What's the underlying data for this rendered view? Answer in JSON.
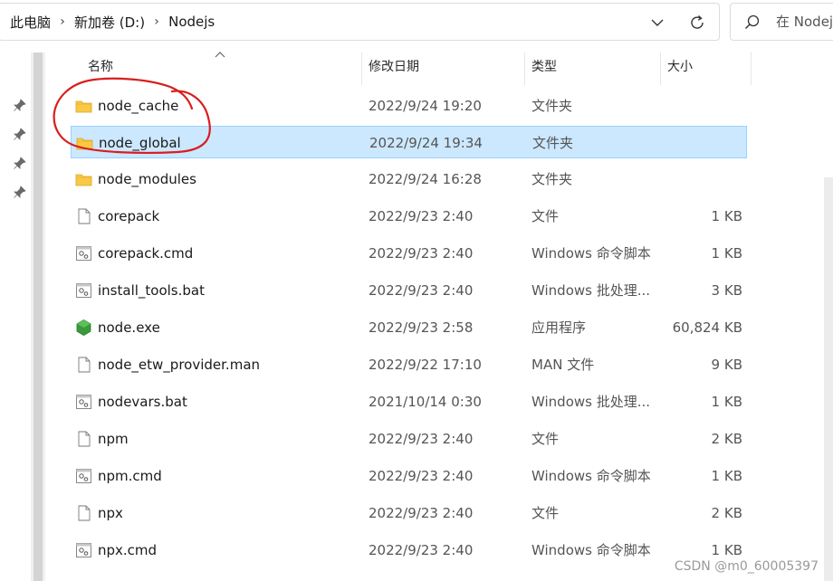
{
  "address_bar": {
    "crumbs": [
      "此电脑",
      "新加卷 (D:)",
      "Nodejs"
    ]
  },
  "search": {
    "placeholder": "在 Nodejs"
  },
  "columns": {
    "name": "名称",
    "date": "修改日期",
    "type": "类型",
    "size": "大小"
  },
  "files": [
    {
      "name": "node_cache",
      "date": "2022/9/24 19:20",
      "type": "文件夹",
      "size": "",
      "icon": "folder-icon"
    },
    {
      "name": "node_global",
      "date": "2022/9/24 19:34",
      "type": "文件夹",
      "size": "",
      "icon": "folder-icon",
      "selected": true
    },
    {
      "name": "node_modules",
      "date": "2022/9/24 16:28",
      "type": "文件夹",
      "size": "",
      "icon": "folder-icon"
    },
    {
      "name": "corepack",
      "date": "2022/9/23 2:40",
      "type": "文件",
      "size": "1 KB",
      "icon": "file-icon"
    },
    {
      "name": "corepack.cmd",
      "date": "2022/9/23 2:40",
      "type": "Windows 命令脚本",
      "size": "1 KB",
      "icon": "script-icon"
    },
    {
      "name": "install_tools.bat",
      "date": "2022/9/23 2:40",
      "type": "Windows 批处理...",
      "size": "3 KB",
      "icon": "script-icon"
    },
    {
      "name": "node.exe",
      "date": "2022/9/23 2:58",
      "type": "应用程序",
      "size": "60,824 KB",
      "icon": "node-icon"
    },
    {
      "name": "node_etw_provider.man",
      "date": "2022/9/22 17:10",
      "type": "MAN 文件",
      "size": "9 KB",
      "icon": "file-icon"
    },
    {
      "name": "nodevars.bat",
      "date": "2021/10/14 0:30",
      "type": "Windows 批处理...",
      "size": "1 KB",
      "icon": "script-icon"
    },
    {
      "name": "npm",
      "date": "2022/9/23 2:40",
      "type": "文件",
      "size": "2 KB",
      "icon": "file-icon"
    },
    {
      "name": "npm.cmd",
      "date": "2022/9/23 2:40",
      "type": "Windows 命令脚本",
      "size": "1 KB",
      "icon": "script-icon"
    },
    {
      "name": "npx",
      "date": "2022/9/23 2:40",
      "type": "文件",
      "size": "2 KB",
      "icon": "file-icon"
    },
    {
      "name": "npx.cmd",
      "date": "2022/9/23 2:40",
      "type": "Windows 命令脚本",
      "size": "1 KB",
      "icon": "script-icon"
    }
  ],
  "watermark": "CSDN @m0_60005397",
  "colors": {
    "selection_bg": "#cce8ff",
    "selection_border": "#99d1ff",
    "folder": "#f8c846",
    "annotation": "#d81e1e",
    "node_green": "#3a9a3a"
  }
}
